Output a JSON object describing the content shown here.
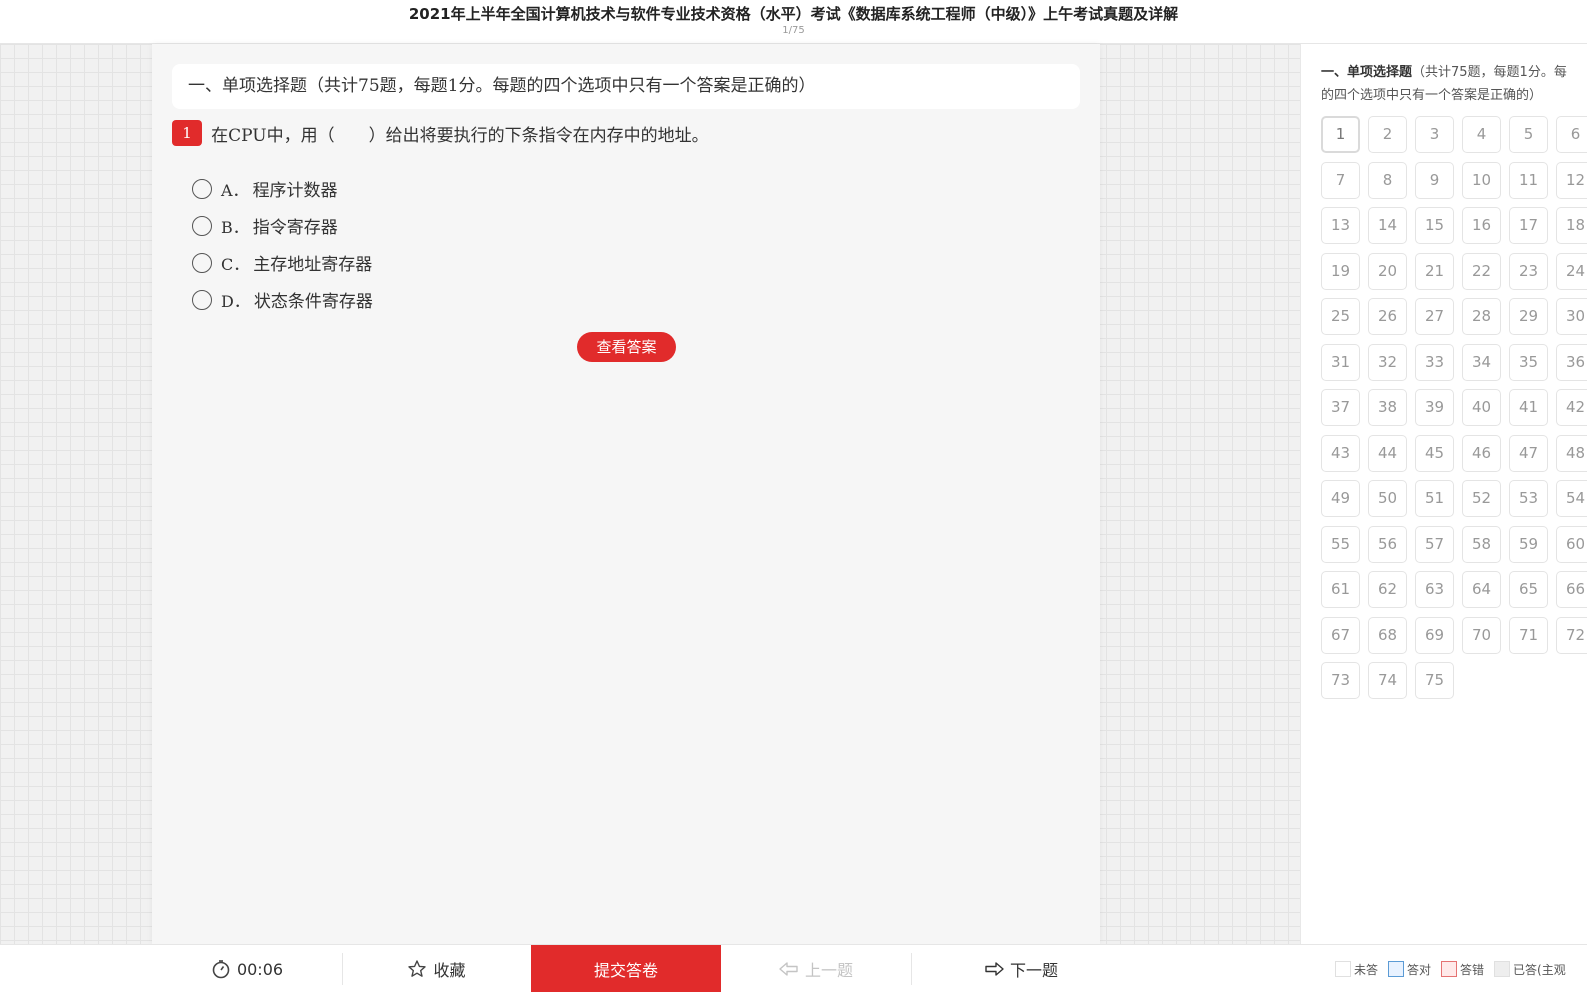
{
  "header": {
    "title": "2021年上半年全国计算机技术与软件专业技术资格（水平）考试《数据库系统工程师（中级）》上午考试真题及详解",
    "page_counter": "1/75"
  },
  "section": {
    "heading": "一、单项选择题（共计75题，每题1分。每题的四个选项中只有一个答案是正确的）"
  },
  "question": {
    "number": "1",
    "text": "在CPU中，用（　　）给出将要执行的下条指令在内存中的地址。",
    "options": [
      {
        "letter": "A．",
        "text": "程序计数器"
      },
      {
        "letter": "B．",
        "text": "指令寄存器"
      },
      {
        "letter": "C．",
        "text": "主存地址寄存器"
      },
      {
        "letter": "D．",
        "text": "状态条件寄存器"
      }
    ],
    "view_answer_label": "查看答案"
  },
  "sidebar": {
    "title_bold": "一、单项选择题",
    "title_rest": "（共计75题，每题1分。每",
    "title_line2": "的四个选项中只有一个答案是正确的）",
    "numbers": [
      "1",
      "2",
      "3",
      "4",
      "5",
      "6",
      "7",
      "8",
      "9",
      "10",
      "11",
      "12",
      "13",
      "14",
      "15",
      "16",
      "17",
      "18",
      "19",
      "20",
      "21",
      "22",
      "23",
      "24",
      "25",
      "26",
      "27",
      "28",
      "29",
      "30",
      "31",
      "32",
      "33",
      "34",
      "35",
      "36",
      "37",
      "38",
      "39",
      "40",
      "41",
      "42",
      "43",
      "44",
      "45",
      "46",
      "47",
      "48",
      "49",
      "50",
      "51",
      "52",
      "53",
      "54",
      "55",
      "56",
      "57",
      "58",
      "59",
      "60",
      "61",
      "62",
      "63",
      "64",
      "65",
      "66",
      "67",
      "68",
      "69",
      "70",
      "71",
      "72",
      "73",
      "74",
      "75"
    ],
    "current": "1"
  },
  "footer": {
    "timer": "00:06",
    "favorite": "收藏",
    "submit": "提交答卷",
    "prev": "上一题",
    "next": "下一题",
    "legend": [
      "未答",
      "答对",
      "答错",
      "已答(主观"
    ],
    "legend_colors": [
      "#ffffff",
      "#e8f2ff",
      "#ffeaea",
      "#eeeeee"
    ],
    "legend_borders": [
      "#e0e0e0",
      "#5b9bd5",
      "#e57373",
      "#e0e0e0"
    ]
  }
}
